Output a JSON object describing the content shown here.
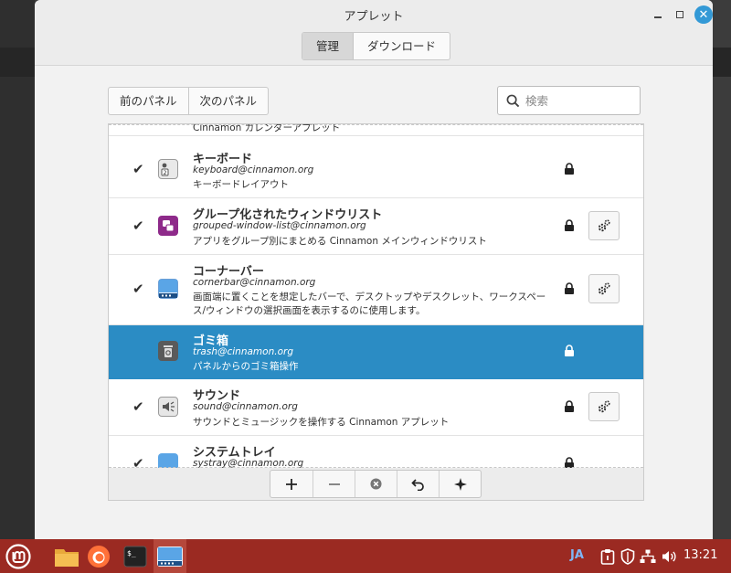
{
  "window": {
    "title": "アプレット"
  },
  "tabs": [
    {
      "label": "管理",
      "active": true
    },
    {
      "label": "ダウンロード",
      "active": false
    }
  ],
  "panel_nav": {
    "prev_label": "前のパネル",
    "next_label": "次のパネル"
  },
  "search": {
    "placeholder": "検索",
    "value": ""
  },
  "list": {
    "partial_top_desc": "Cinnamon カレンダーアプレット",
    "items": [
      {
        "name": "キーボード",
        "uuid": "keyboard@cinnamon.org",
        "desc": "キーボードレイアウト",
        "enabled": true,
        "locked": true,
        "configurable": false,
        "icon": "keyboard-icon"
      },
      {
        "name": "グループ化されたウィンドウリスト",
        "uuid": "grouped-window-list@cinnamon.org",
        "desc": "アプリをグループ別にまとめる Cinnamon メインウィンドウリスト",
        "enabled": true,
        "locked": true,
        "configurable": true,
        "icon": "window-list-icon"
      },
      {
        "name": "コーナーバー",
        "uuid": "cornerbar@cinnamon.org",
        "desc": "画面端に置くことを想定したバーで、デスクトップやデスクレット、ワークスペース/ウィンドウの選択画面を表示するのに使用します。",
        "enabled": true,
        "locked": true,
        "configurable": true,
        "icon": "cornerbar-icon"
      },
      {
        "name": "ゴミ箱",
        "uuid": "trash@cinnamon.org",
        "desc": "パネルからのゴミ箱操作",
        "enabled": false,
        "locked": true,
        "configurable": false,
        "selected": true,
        "icon": "trash-icon"
      },
      {
        "name": "サウンド",
        "uuid": "sound@cinnamon.org",
        "desc": "サウンドとミュージックを操作する Cinnamon アプレット",
        "enabled": true,
        "locked": true,
        "configurable": true,
        "icon": "sound-icon"
      },
      {
        "name": "システムトレイ",
        "uuid": "systray@cinnamon.org",
        "desc": "",
        "enabled": true,
        "locked": true,
        "configurable": false,
        "icon": "systray-icon"
      }
    ]
  },
  "toolbar": [
    "add-icon",
    "remove-icon",
    "clear-icon",
    "undo-icon",
    "more-icon"
  ],
  "taskbar": {
    "apps": [
      "mint-menu-icon",
      "files-icon",
      "firefox-icon",
      "terminal-icon",
      "applets-icon"
    ],
    "lang": "JA",
    "clock": "13:21"
  },
  "colors": {
    "selection": "#2b8cc4",
    "taskbar": "#9b2a22",
    "close_button": "#3399d6"
  }
}
